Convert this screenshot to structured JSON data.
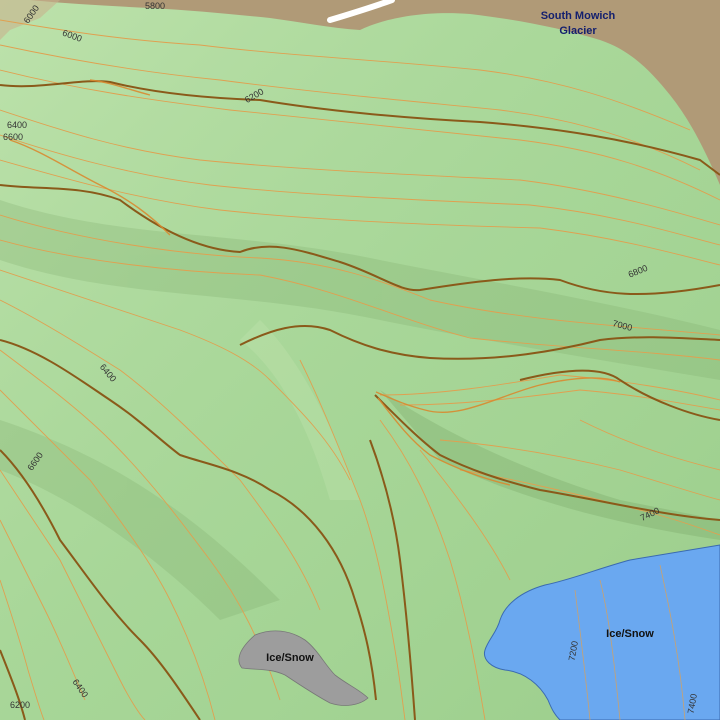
{
  "map": {
    "colors": {
      "vegetation": "#a9d89a",
      "vegetation_light": "#c4e6b2",
      "rock": "#b09a77",
      "glacier_blue": "#6aa8f0",
      "ice_gray": "#9d9d9d",
      "index_contour": "#8a5a1a",
      "intermediate_contour": "#e0a050",
      "road_white": "#ffffff"
    },
    "labels": {
      "glacier_name_line1": "South Mowich",
      "glacier_name_line2": "Glacier",
      "ice_snow_gray": "Ice/Snow",
      "ice_snow_blue": "Ice/Snow"
    },
    "contour_labels": [
      {
        "text": "5800"
      },
      {
        "text": "6000"
      },
      {
        "text": "6000"
      },
      {
        "text": "6200"
      },
      {
        "text": "6400"
      },
      {
        "text": "6600"
      },
      {
        "text": "6800"
      },
      {
        "text": "7000"
      },
      {
        "text": "6400"
      },
      {
        "text": "6600"
      },
      {
        "text": "7400"
      },
      {
        "text": "7200"
      },
      {
        "text": "7400"
      },
      {
        "text": "6400"
      },
      {
        "text": "6200"
      }
    ]
  }
}
